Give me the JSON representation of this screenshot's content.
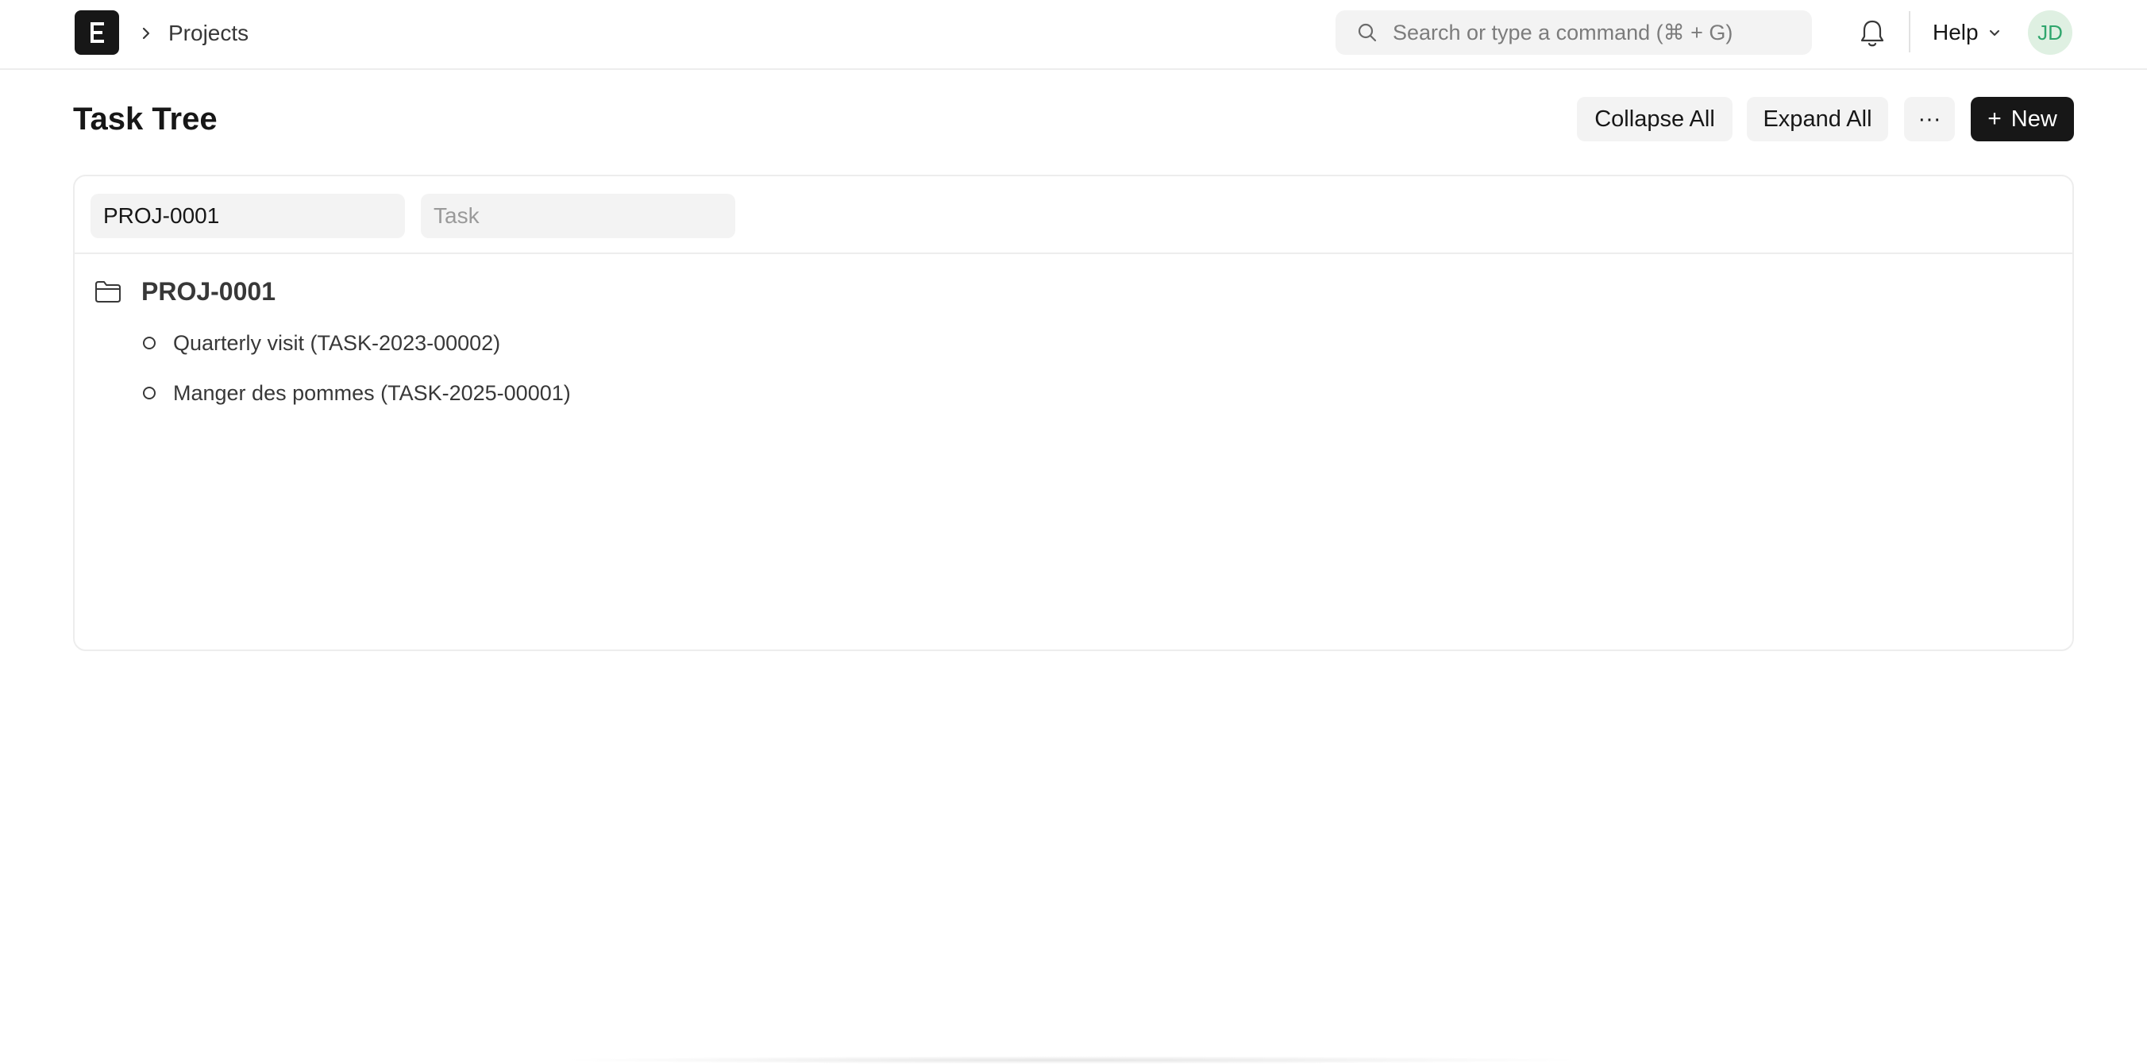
{
  "navbar": {
    "breadcrumb": "Projects",
    "search_placeholder": "Search or type a command (⌘ + G)",
    "help_label": "Help",
    "avatar_initials": "JD"
  },
  "page": {
    "title": "Task Tree",
    "actions": {
      "collapse_all": "Collapse All",
      "expand_all": "Expand All",
      "more": "···",
      "new_label": "New",
      "new_icon": "+"
    }
  },
  "filters": {
    "project_value": "PROJ-0001",
    "task_placeholder": "Task"
  },
  "tree": {
    "root": {
      "label": "PROJ-0001",
      "icon": "folder-icon"
    },
    "children": [
      {
        "label": "Quarterly visit (TASK-2023-00002)"
      },
      {
        "label": "Manger des pommes (TASK-2025-00001)"
      }
    ]
  },
  "colors": {
    "primary_button": "#171717",
    "avatar_bg": "#dff0e2",
    "avatar_text": "#30a66d",
    "control_bg": "#f3f3f3"
  }
}
